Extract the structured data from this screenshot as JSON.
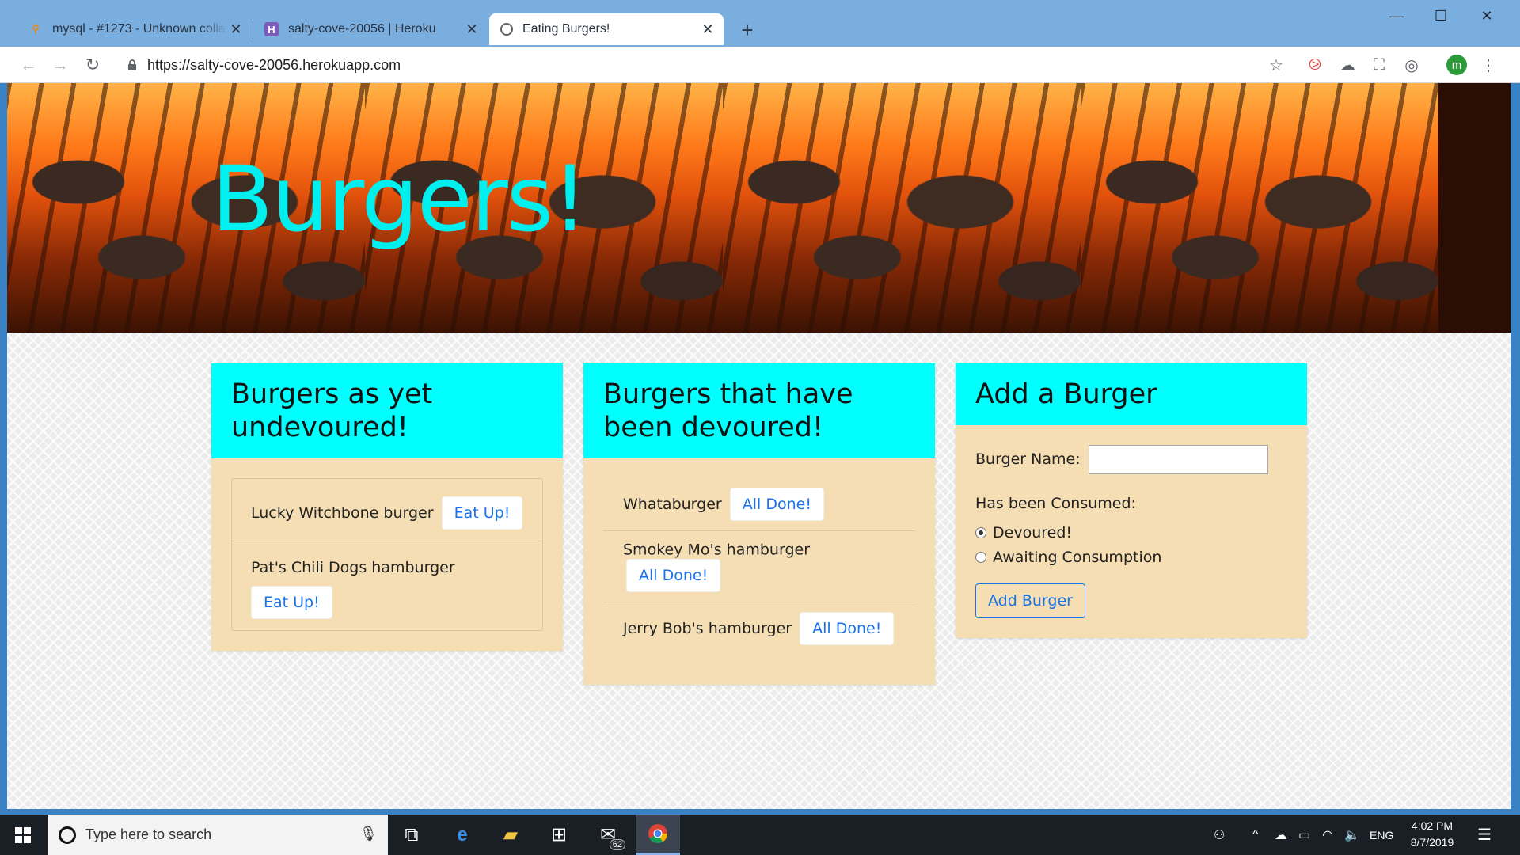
{
  "browser": {
    "tabs": [
      {
        "title": "mysql - #1273 - Unknown collation",
        "favicon": "sql-icon",
        "active": false
      },
      {
        "title": "salty-cove-20056 | Heroku",
        "favicon": "heroku-icon",
        "active": false
      },
      {
        "title": "Eating Burgers!",
        "favicon": "globe-icon",
        "active": true
      }
    ],
    "url": "https://salty-cove-20056.herokuapp.com",
    "profile_initial": "m"
  },
  "page": {
    "hero_title": "Burgers!",
    "undevoured": {
      "heading": "Burgers as yet undevoured!",
      "items": [
        {
          "name": "Lucky Witchbone burger",
          "button": "Eat Up!"
        },
        {
          "name": "Pat's Chili Dogs hamburger",
          "button": "Eat Up!"
        }
      ]
    },
    "devoured": {
      "heading": "Burgers that have been devoured!",
      "items": [
        {
          "name": "Whataburger",
          "button": "All Done!"
        },
        {
          "name": "Smokey Mo's hamburger",
          "button": "All Done!"
        },
        {
          "name": "Jerry Bob's hamburger",
          "button": "All Done!"
        }
      ]
    },
    "add_form": {
      "heading": "Add a Burger",
      "name_label": "Burger Name:",
      "name_value": "",
      "consumed_label": "Has been Consumed:",
      "options": [
        {
          "label": "Devoured!",
          "checked": true
        },
        {
          "label": "Awaiting Consumption",
          "checked": false
        }
      ],
      "submit": "Add Burger"
    }
  },
  "taskbar": {
    "search_placeholder": "Type here to search",
    "mail_badge": "62",
    "language": "ENG",
    "time": "4:02 PM",
    "date": "8/7/2019"
  }
}
